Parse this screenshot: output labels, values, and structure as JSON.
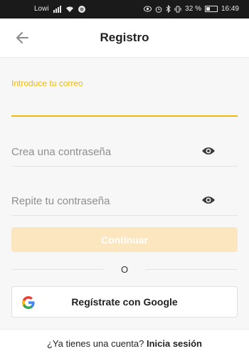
{
  "status_bar": {
    "carrier": "Lowi",
    "battery": "32 %",
    "time": "16:49"
  },
  "header": {
    "title": "Registro",
    "back_icon": "arrow-left-icon"
  },
  "form": {
    "email_label": "Introduce tu correo",
    "email_value": "",
    "password_placeholder": "Crea una contraseña",
    "repeat_password_placeholder": "Repite tu contraseña",
    "eye_icon": "eye-icon"
  },
  "continue_label": "Continuar",
  "divider_text": "O",
  "google_label": "Regístrate con Google",
  "footer": {
    "prompt": "¿Ya tienes una cuenta?",
    "login_link": "Inicia sesión"
  },
  "colors": {
    "accent": "#f0b90b",
    "continue_disabled": "#fbe6c0",
    "background": "#f7f7f7"
  }
}
